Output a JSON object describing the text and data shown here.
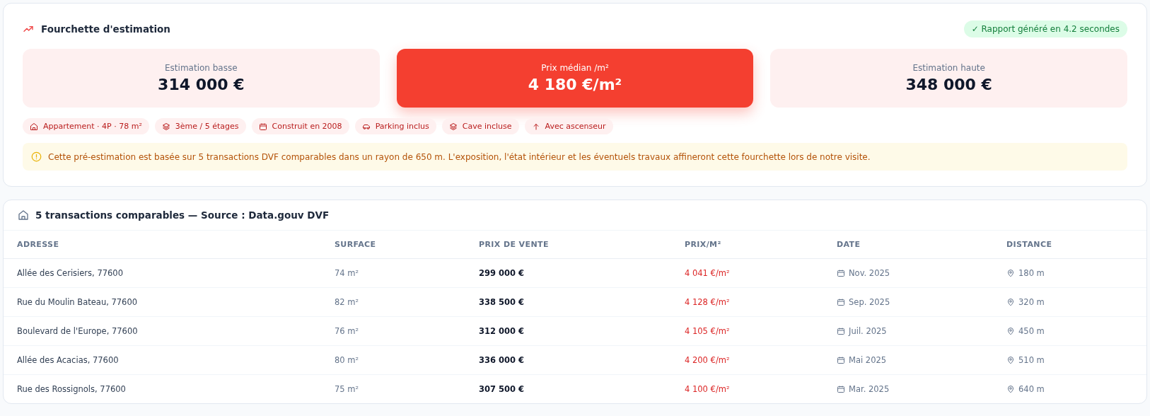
{
  "estimate": {
    "title": "Fourchette d'estimation",
    "badge": "✓ Rapport généré en 4.2 secondes",
    "cards": [
      {
        "label": "Estimation basse",
        "value": "314 000 €",
        "selected": false
      },
      {
        "label": "Prix médian /m²",
        "value": "4 180 €/m²",
        "selected": true
      },
      {
        "label": "Estimation haute",
        "value": "348 000 €",
        "selected": false
      }
    ],
    "tags": [
      "Appartement · 4P · 78 m²",
      "3ème / 5 étages",
      "Construit en 2008",
      "Parking inclus",
      "Cave incluse",
      "Avec ascenseur"
    ],
    "notice": "Cette pré-estimation est basée sur 5 transactions DVF comparables dans un rayon de 650 m. L'exposition, l'état intérieur et les éventuels travaux affineront cette fourchette lors de notre visite."
  },
  "comparables": {
    "title": "5 transactions comparables — Source : Data.gouv DVF",
    "columns": [
      "ADRESSE",
      "SURFACE",
      "PRIX DE VENTE",
      "PRIX/M²",
      "DATE",
      "DISTANCE"
    ],
    "rows": [
      {
        "address": "Allée des Cerisiers, 77600",
        "surface": "74 m²",
        "price": "299 000 €",
        "price_m2": "4 041 €/m²",
        "date": "Nov. 2025",
        "distance": "180 m"
      },
      {
        "address": "Rue du Moulin Bateau, 77600",
        "surface": "82 m²",
        "price": "338 500 €",
        "price_m2": "4 128 €/m²",
        "date": "Sep. 2025",
        "distance": "320 m"
      },
      {
        "address": "Boulevard de l'Europe, 77600",
        "surface": "76 m²",
        "price": "312 000 €",
        "price_m2": "4 105 €/m²",
        "date": "Juil. 2025",
        "distance": "450 m"
      },
      {
        "address": "Allée des Acacias, 77600",
        "surface": "80 m²",
        "price": "336 000 €",
        "price_m2": "4 200 €/m²",
        "date": "Mai 2025",
        "distance": "510 m"
      },
      {
        "address": "Rue des Rossignols, 77600",
        "surface": "75 m²",
        "price": "307 500 €",
        "price_m2": "4 100 €/m²",
        "date": "Mar. 2025",
        "distance": "640 m"
      }
    ]
  }
}
